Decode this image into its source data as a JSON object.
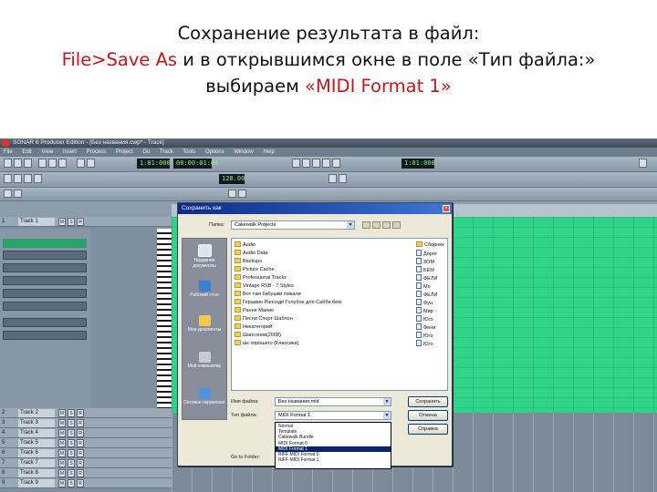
{
  "caption": {
    "line1": "Сохранение результата в файл:",
    "line2_menu": "File>Save As",
    "line2_rest": " и в открывшимся окне в поле «Тип файла:»",
    "line3_pre": "выбираем ",
    "line3_format": "«MIDI Format 1»"
  },
  "app": {
    "title": "SONAR 6 Producer Edition - [Без названия.cwp* - Track]",
    "menu": [
      "File",
      "Edit",
      "View",
      "Insert",
      "Process",
      "Project",
      "Go",
      "Track",
      "Tools",
      "Options",
      "Window",
      "Help"
    ],
    "time_display": "1:01:000",
    "time_display2": "00:00:01:00",
    "tempo_display": "120.00",
    "track_name": "Track 1",
    "tracks": [
      "Track 2",
      "Track 3",
      "Track 4",
      "Track 5",
      "Track 6",
      "Track 7",
      "Track 8",
      "Track 9"
    ],
    "track_numbers": [
      "1",
      "2",
      "3",
      "4",
      "5",
      "6",
      "7",
      "8",
      "9"
    ]
  },
  "dialog": {
    "title": "Сохранить как",
    "folder_label": "Папка:",
    "folder_value": "Cakewalk Projects",
    "places": [
      "Недавние документы",
      "Рабочий стол",
      "Мои документы",
      "Мой компьютер",
      "Сетевое окружение"
    ],
    "folders_left": [
      "Audio",
      "Audio Data",
      "Backups",
      "Picture Cache",
      "Professional Tracks",
      "Vintage RSB - 7 Styles",
      "Вот там бабушки пожали",
      "Гершвин Рапсоди Голубое для Сабби бем",
      "Ранне Мание",
      "Песни Спорт Шаблон",
      "Некатегорий",
      "Шансонов(2008)",
      "шк хорошего (Классика)"
    ],
    "folders_right": [
      "Сборник",
      "Дорог",
      "3ОМ",
      "БЕМ",
      "ФЕЛИ",
      "Мо",
      "ФЕЛИ",
      "Фун",
      "Мир",
      "Юго",
      "Фени",
      "Юго",
      "Юго"
    ],
    "filename_label": "Имя файла:",
    "filename_value": "Без названия.mid",
    "filetype_label": "Тип файла:",
    "filetype_value": "MIDI Format 1",
    "save_button": "Сохранить",
    "cancel_button": "Отмена",
    "help_button": "Справка",
    "go_to_folder_label": "Go to Folder:",
    "filetype_options": [
      "Normal",
      "Template",
      "Cakewalk Bundle",
      "MIDI Format 0",
      "MIDI Format 1",
      "RIFF MIDI Format 0",
      "RIFF MIDI Format 1"
    ],
    "selected_option_index": 4
  }
}
